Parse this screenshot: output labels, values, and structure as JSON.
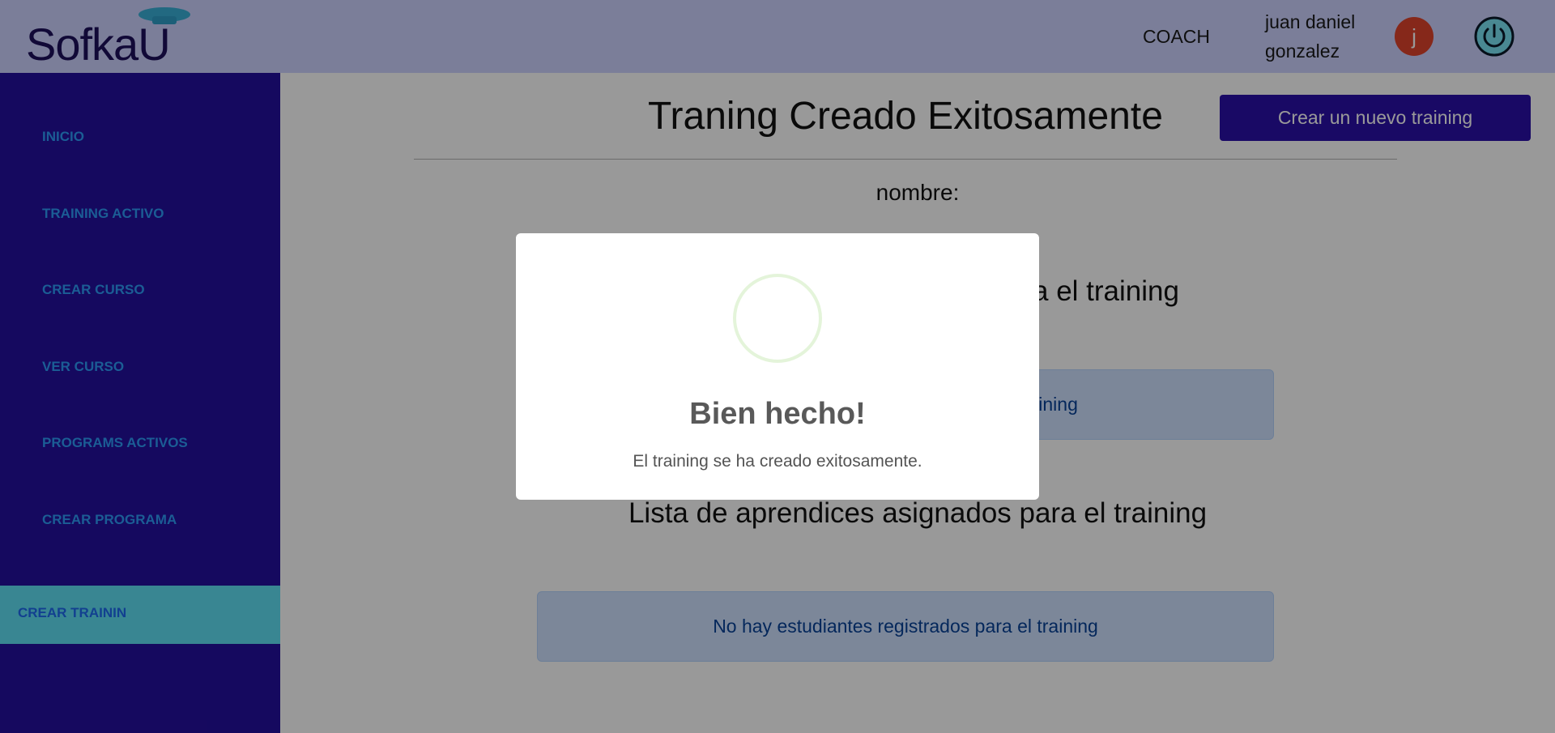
{
  "header": {
    "logo_text": "Sofka",
    "logo_letter": "U",
    "role": "COACH",
    "user_line1": "juan daniel",
    "user_line2": "gonzalez",
    "avatar_initial": "j",
    "power_icon": "power-icon"
  },
  "sidebar": {
    "items": [
      {
        "label": "INICIO"
      },
      {
        "label": "TRAINING ACTIVO"
      },
      {
        "label": "CREAR CURSO"
      },
      {
        "label": "VER CURSO"
      },
      {
        "label": "PROGRAMS ACTIVOS"
      },
      {
        "label": "CREAR PROGRAMA"
      }
    ],
    "active_label": "CREAR TRAININ"
  },
  "main": {
    "title": "Traning Creado Exitosamente",
    "create_button": "Crear un nuevo training",
    "name_label": "nombre:",
    "name_value": "",
    "courses_title": "Lista de cursos asignados para el training",
    "courses_empty": "No hay cursos registrados para el training",
    "students_title": "Lista de aprendices asignados para el training",
    "students_empty": "No hay estudiantes registrados para el training"
  },
  "modal": {
    "title": "Bien hecho!",
    "text": "El training se ha creado exitosamente."
  },
  "colors": {
    "header_bg": "#cdd2ff",
    "sidebar_bg": "#240f9e",
    "sidebar_text": "#2d9cf8",
    "active_bg": "#5fe0f4",
    "button_bg": "#2b0fa8",
    "avatar_bg": "#e0432c"
  }
}
